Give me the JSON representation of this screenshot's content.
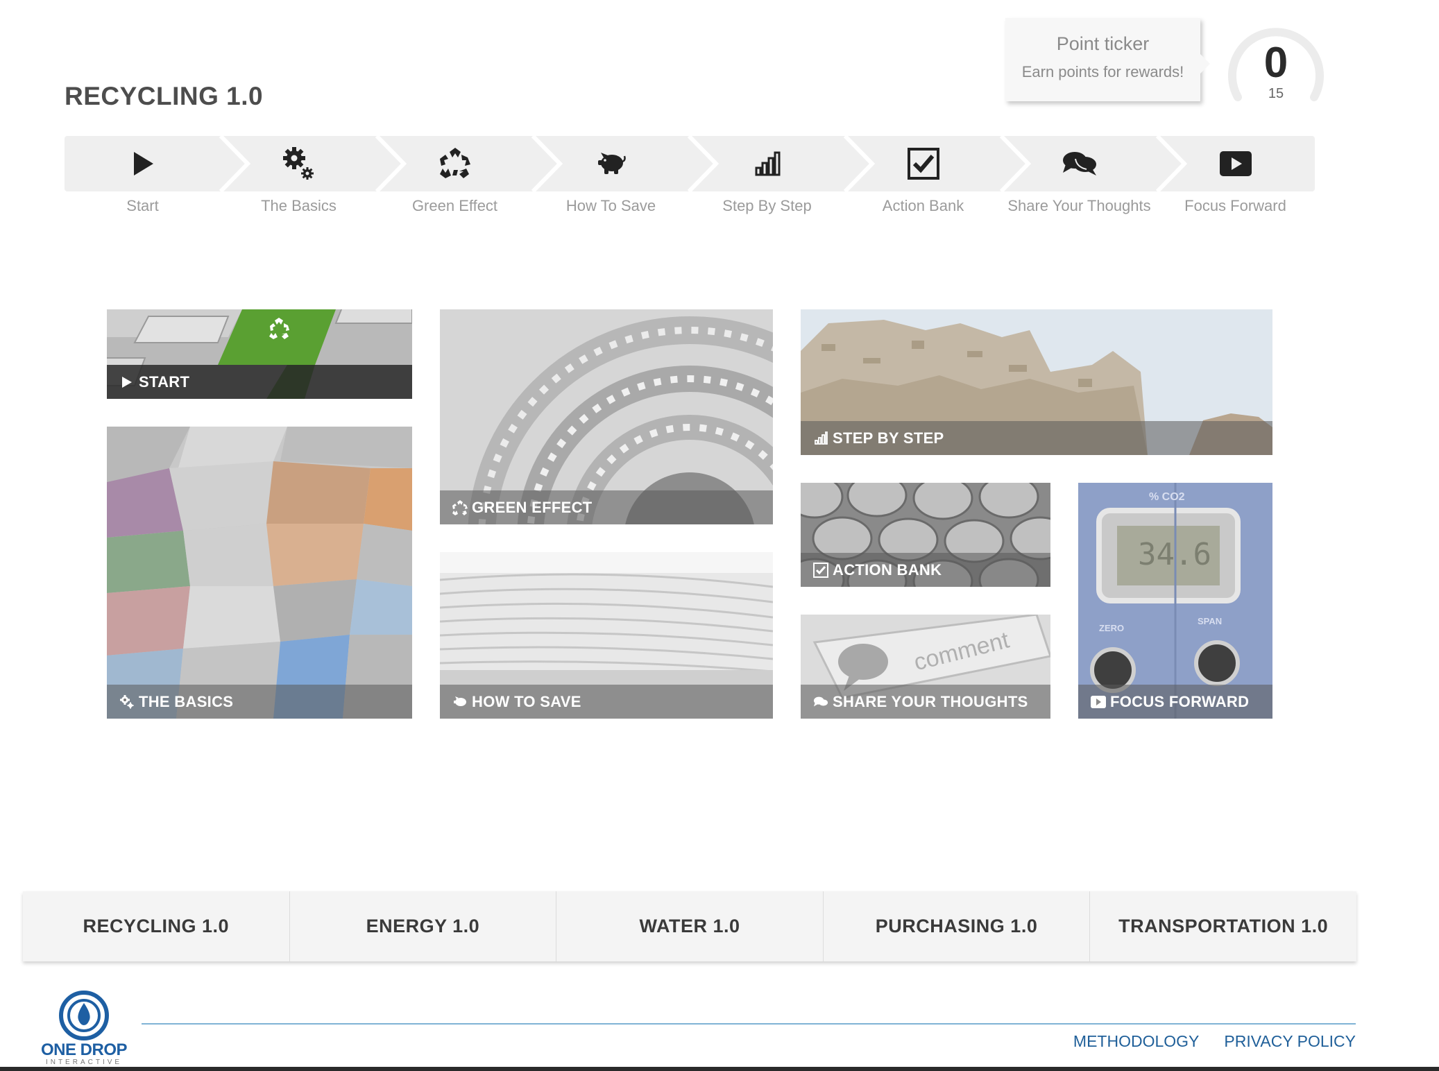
{
  "course_title": "RECYCLING 1.0",
  "ticker": {
    "title": "Point ticker",
    "subtitle": "Earn points for rewards!",
    "points": "0",
    "max": "15",
    "progress_fraction": 0
  },
  "steps": [
    {
      "label": "Start",
      "icon": "play-icon"
    },
    {
      "label": "The Basics",
      "icon": "gears-icon"
    },
    {
      "label": "Green Effect",
      "icon": "recycle-icon"
    },
    {
      "label": "How To Save",
      "icon": "piggy-bank-icon"
    },
    {
      "label": "Step By Step",
      "icon": "bar-chart-icon"
    },
    {
      "label": "Action Bank",
      "icon": "checkbox-icon"
    },
    {
      "label": "Share Your Thoughts",
      "icon": "comments-icon"
    },
    {
      "label": "Focus Forward",
      "icon": "video-play-icon"
    }
  ],
  "tiles": {
    "start": "START",
    "the_basics": "THE BASICS",
    "green_effect": "GREEN EFFECT",
    "how_to_save": "HOW TO SAVE",
    "step_by_step": "STEP BY STEP",
    "action_bank": "ACTION BANK",
    "share_your_thoughts": "SHARE YOUR THOUGHTS",
    "focus_forward": "FOCUS FORWARD",
    "comment_key_text": "comment",
    "gauge_reading": "34.6",
    "gauge_label_top": "% CO2",
    "gauge_label_zero": "ZERO",
    "gauge_label_span": "SPAN"
  },
  "course_tabs": [
    "RECYCLING 1.0",
    "ENERGY 1.0",
    "WATER 1.0",
    "PURCHASING 1.0",
    "TRANSPORTATION 1.0"
  ],
  "footer": {
    "logo_text": "ONE DROP",
    "logo_sub": "INTERACTIVE",
    "methodology": "METHODOLOGY",
    "privacy_policy": "PRIVACY POLICY"
  },
  "colors": {
    "accent_green": "#5aa032",
    "link_blue": "#1f5f99",
    "logo_blue": "#1e5fa3"
  }
}
